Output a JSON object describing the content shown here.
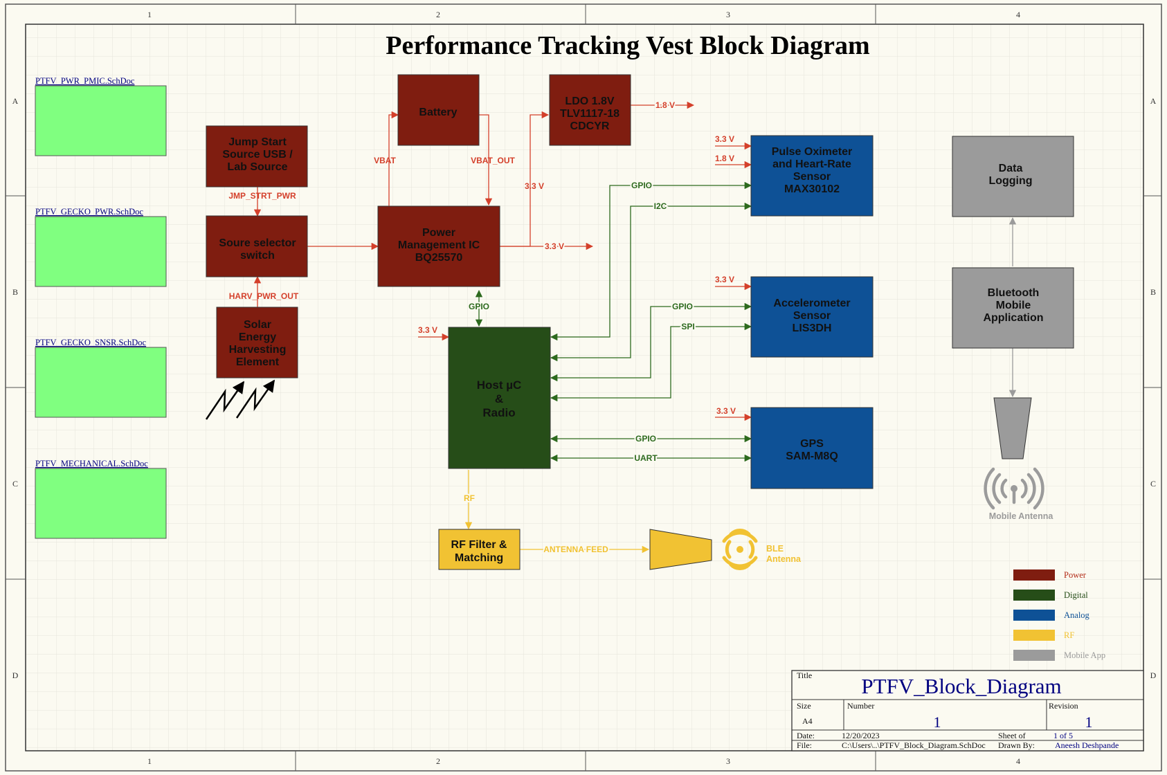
{
  "title": "Performance Tracking Vest Block Diagram",
  "colors": {
    "power": "#7f1d10",
    "digital": "#264d18",
    "analog": "#0e5196",
    "rf": "#f1c233",
    "mobile": "#9b9b9b",
    "sheet_green": "#80ff80",
    "wire_power": "#d4402b",
    "wire_digital": "#2d6a1e",
    "wire_rf": "#f1c233",
    "wire_mobile": "#9b9b9b",
    "text_blue": "#000080"
  },
  "border": {
    "columns": [
      "1",
      "2",
      "3",
      "4"
    ],
    "rows": [
      "A",
      "B",
      "C",
      "D"
    ]
  },
  "sheets": [
    "PTFV_PWR_PMIC.SchDoc",
    "PTFV_GECKO_PWR.SchDoc",
    "PTFV_GECKO_SNSR.SchDoc",
    "PTFV_MECHANICAL.SchDoc"
  ],
  "blocks": {
    "jump_start": [
      "Jump Start",
      "Source USB /",
      "Lab Source"
    ],
    "source_selector": [
      "Soure selector",
      "switch"
    ],
    "solar": [
      "Solar",
      "Energy",
      "Harvesting",
      "Element"
    ],
    "battery": [
      "Battery"
    ],
    "ldo": [
      "LDO 1.8V",
      "TLV1117-18",
      "CDCYR"
    ],
    "pmic": [
      "Power",
      "Management IC",
      "BQ25570"
    ],
    "host": [
      "Host µC",
      "&",
      "Radio"
    ],
    "pulse_ox": [
      "Pulse Oximeter",
      "and Heart-Rate",
      "Sensor",
      "MAX30102"
    ],
    "accel": [
      "Accelerometer",
      "Sensor",
      "LIS3DH"
    ],
    "gps": [
      "GPS",
      "SAM-M8Q"
    ],
    "rf_filter": [
      "RF Filter &",
      "Matching"
    ],
    "data_logging": [
      "Data",
      "Logging"
    ],
    "bt_app": [
      "Bluetooth",
      "Mobile",
      "Application"
    ]
  },
  "nets": {
    "jmp_strt_pwr": "JMP_STRT_PWR",
    "harv_pwr_out": "HARV_PWR_OUT",
    "vbat": "VBAT",
    "vbat_out": "VBAT_OUT",
    "v33_ldo_feed": "3.3 V",
    "v18_out": "1.8 V",
    "v33_out": "3.3 V",
    "gpio_pmic_host": "GPIO",
    "v33_host": "3.3 V",
    "v33_pulse": "3.3 V",
    "v18_pulse": "1.8 V",
    "gpio_pulse": "GPIO",
    "i2c_pulse": "I2C",
    "v33_accel": "3.3 V",
    "gpio_accel": "GPIO",
    "spi_accel": "SPI",
    "v33_gps": "3.3 V",
    "gpio_gps": "GPIO",
    "uart_gps": "UART",
    "rf": "RF",
    "antenna_feed": "ANTENNA FEED"
  },
  "antennas": {
    "ble": [
      "BLE",
      "Antenna"
    ],
    "mobile": "Mobile Antenna"
  },
  "legend": [
    {
      "label": "Power",
      "color": "#7f1d10",
      "text_color": "#b22a16"
    },
    {
      "label": "Digital",
      "color": "#264d18",
      "text_color": "#264d18"
    },
    {
      "label": "Analog",
      "color": "#0e5196",
      "text_color": "#0e5196"
    },
    {
      "label": "RF",
      "color": "#f1c233",
      "text_color": "#f1c233"
    },
    {
      "label": "Mobile App",
      "color": "#9b9b9b",
      "text_color": "#9b9b9b"
    }
  ],
  "title_block": {
    "title_label": "Title",
    "title_value": "PTFV_Block_Diagram",
    "size_label": "Size",
    "size_value": "A4",
    "number_label": "Number",
    "number_value": "1",
    "revision_label": "Revision",
    "revision_value": "1",
    "date_label": "Date:",
    "date_value": "12/20/2023",
    "sheet_label": "Sheet   of",
    "sheet_value": "1 of  5",
    "file_label": "File:",
    "file_value": "C:\\Users\\..\\PTFV_Block_Diagram.SchDoc",
    "drawn_label": "Drawn By:",
    "drawn_value": "Aneesh Deshpande"
  }
}
